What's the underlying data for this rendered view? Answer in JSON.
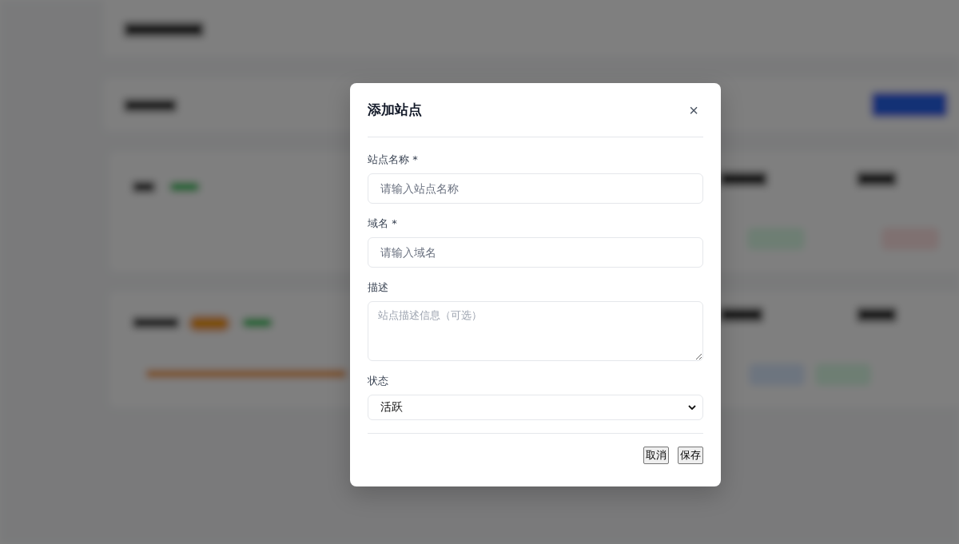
{
  "dialog": {
    "title": "添加站点",
    "close": "×",
    "fields": [
      {
        "kind": "input",
        "label": "站点名称 *",
        "placeholder": "请输入站点名称"
      },
      {
        "kind": "input",
        "label": "域名 *",
        "placeholder": "请输入域名"
      },
      {
        "kind": "textarea",
        "label": "描述",
        "placeholder": "站点描述信息（可选）"
      },
      {
        "kind": "select",
        "label": "状态",
        "value": "活跃"
      }
    ],
    "buttons": [
      "取消",
      "保存"
    ]
  }
}
